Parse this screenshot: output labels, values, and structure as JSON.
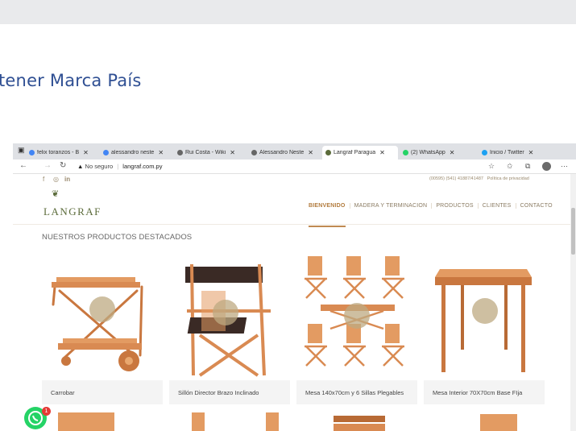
{
  "slide": {
    "title": "tener Marca País"
  },
  "browser": {
    "tabs": [
      {
        "label": "felix toranzos - B",
        "color": "#4285f4"
      },
      {
        "label": "alessandro neste",
        "color": "#4285f4"
      },
      {
        "label": "Rui Costa - Wiki",
        "color": "#666666"
      },
      {
        "label": "Alessandro Neste",
        "color": "#666666"
      },
      {
        "label": "Langraf Paragua",
        "color": "#5b6b3a"
      },
      {
        "label": "(2) WhatsApp",
        "color": "#25d366"
      },
      {
        "label": "Inicio / Twitter",
        "color": "#1da1f2"
      }
    ],
    "address": {
      "security": "No seguro",
      "url": "langraf.com.py"
    }
  },
  "site": {
    "phone": "(00595) (541) 41887/41487",
    "privacy": "Política de privacidad",
    "logo": "LANGRAF",
    "menu": [
      "BIENVENIDO",
      "MADERA Y TERMINACION",
      "PRODUCTOS",
      "CLIENTES",
      "CONTACTO"
    ],
    "section_title": "NUESTROS PRODUCTOS DESTACADOS",
    "products": [
      {
        "name": "Carrobar"
      },
      {
        "name": "Sillón Director Brazo Inclinado"
      },
      {
        "name": "Mesa 140x70cm y 6 Sillas Plegables"
      },
      {
        "name": "Mesa Interior 70X70cm Base FIja"
      }
    ],
    "whatsapp_badge": "1"
  },
  "colors": {
    "wood": "#d98a52",
    "wood_dark": "#b86a35",
    "accent": "#b27b3d",
    "title_blue": "#2f4f93"
  }
}
